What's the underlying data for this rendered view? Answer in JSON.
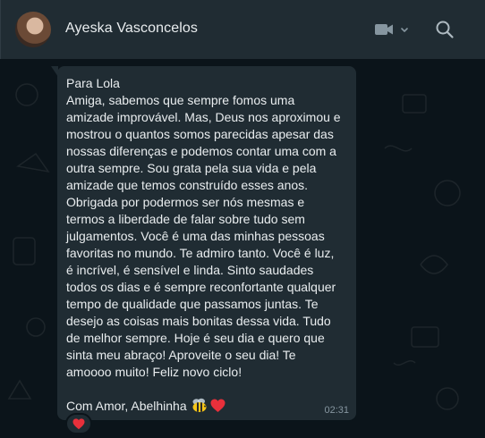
{
  "contact": {
    "name": "Ayeska Vasconcelos"
  },
  "header": {
    "video_icon": "video-call-icon",
    "search_icon": "search-icon"
  },
  "message": {
    "text": "Para Lola\nAmiga, sabemos que sempre fomos uma\namizade improvável. Mas, Deus nos aproximou e\nmostrou o quantos somos parecidas apesar das\nnossas diferenças e podemos contar uma com a\noutra sempre. Sou grata pela sua vida e pela\namizade que temos construído esses anos.\nObrigada por podermos ser nós mesmas e\ntermos a liberdade de falar sobre tudo sem\njulgamentos. Você é uma das minhas pessoas\nfavoritas no mundo. Te admiro tanto. Você é luz,\né incrível, é sensível e linda. Sinto saudades\ntodos os dias e é sempre reconfortante qualquer\ntempo de qualidade que passamos juntas. Te\ndesejo as coisas mais bonitas dessa vida. Tudo\nde melhor sempre. Hoje é seu dia e quero que\nsinta meu abraço! Aproveite o seu dia! Te\namoooo muito! Feliz novo ciclo!",
    "signature": "Com Amor, Abelhinha",
    "signature_emojis": [
      "bee-icon",
      "red-heart-icon"
    ],
    "time": "02:31",
    "reaction_icon": "red-heart-icon"
  },
  "colors": {
    "background": "#0b141a",
    "header": "#202c33",
    "bubble": "#202c33",
    "text": "#e9edef",
    "meta": "#8696a0",
    "heart": "#e8303b"
  }
}
